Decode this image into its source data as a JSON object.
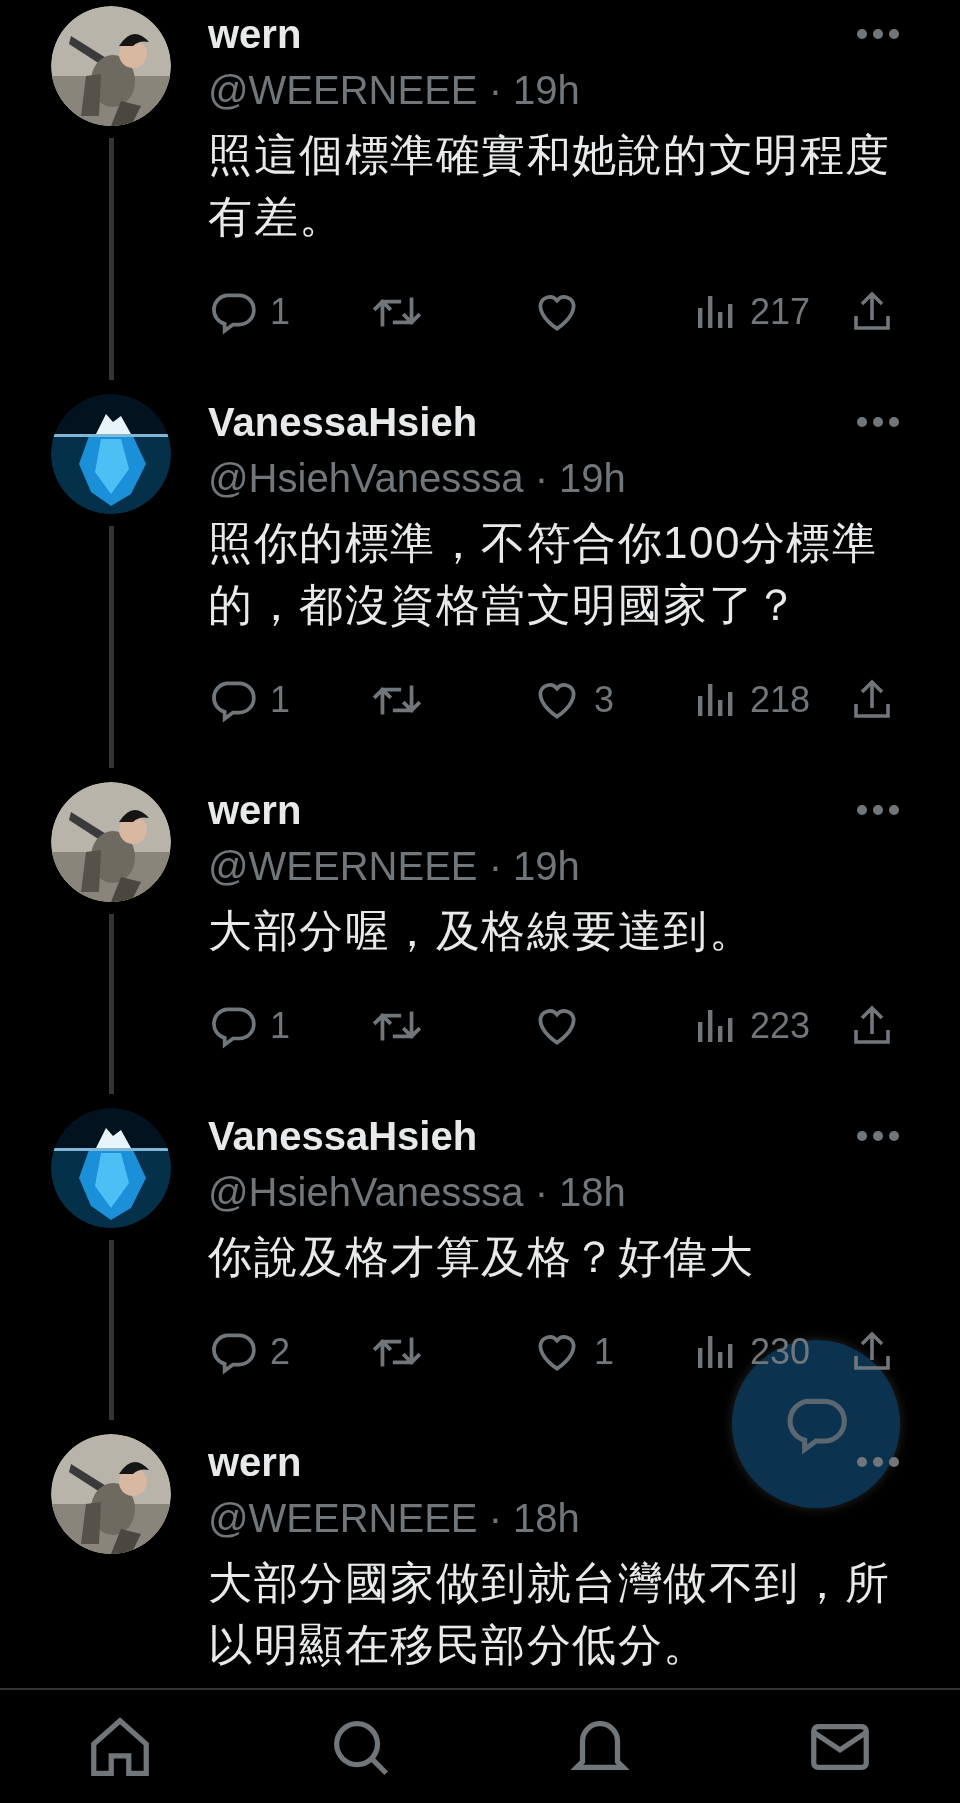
{
  "tweets": [
    {
      "name": "wern",
      "handle_line": "@WEERNEEE · 19h",
      "text": "照這個標準確實和她說的文明程度有差。",
      "replies": "1",
      "views": "217"
    },
    {
      "name": "VanessaHsieh",
      "handle_line": "@HsiehVanesssa · 19h",
      "text": "照你的標準，不符合你100分標準的，都沒資格當文明國家了？",
      "replies": "1",
      "likes": "3",
      "views": "218"
    },
    {
      "name": "wern",
      "handle_line": "@WEERNEEE · 19h",
      "text": "大部分喔，及格線要達到。",
      "replies": "1",
      "views": "223"
    },
    {
      "name": "VanessaHsieh",
      "handle_line": "@HsiehVanesssa · 18h",
      "text": "你說及格才算及格？好偉大",
      "replies": "2",
      "likes": "1",
      "views": "230"
    },
    {
      "name": "wern",
      "handle_line": "@WEERNEEE · 18h",
      "text": "大部分國家做到就台灣做不到，所以明顯在移民部分低分。"
    }
  ]
}
